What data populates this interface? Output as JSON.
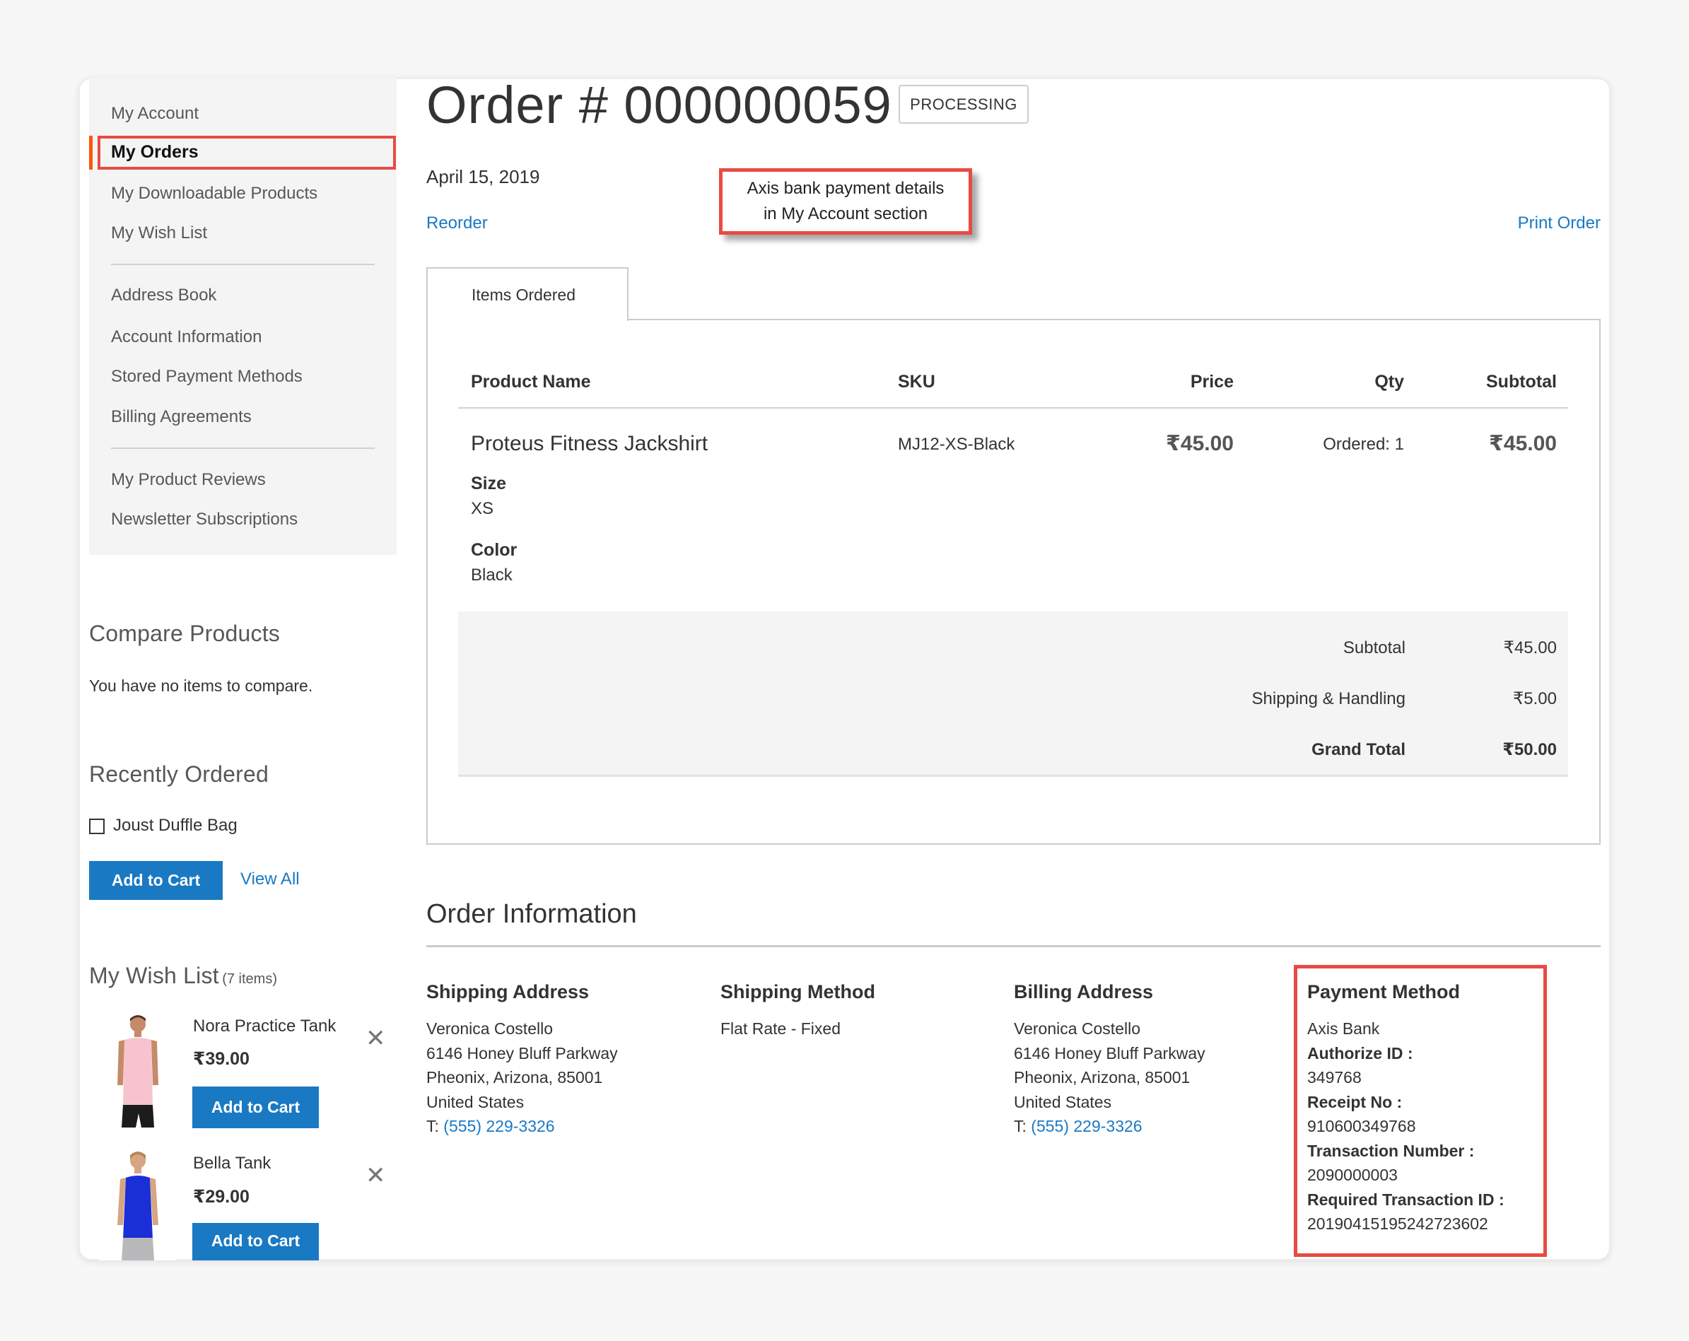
{
  "sidebar": {
    "nav_items": [
      {
        "label": "My Account",
        "active": false
      },
      {
        "label": "My Orders",
        "active": true
      },
      {
        "label": "My Downloadable Products",
        "active": false
      },
      {
        "label": "My Wish List",
        "active": false
      },
      {
        "label": "Address Book",
        "active": false
      },
      {
        "label": "Account Information",
        "active": false
      },
      {
        "label": "Stored Payment Methods",
        "active": false
      },
      {
        "label": "Billing Agreements",
        "active": false
      },
      {
        "label": "My Product Reviews",
        "active": false
      },
      {
        "label": "Newsletter Subscriptions",
        "active": false
      }
    ],
    "compare": {
      "heading": "Compare Products",
      "empty_text": "You have no items to compare."
    },
    "recently_ordered": {
      "heading": "Recently Ordered",
      "items": [
        {
          "label": "Joust Duffle Bag",
          "checked": false
        }
      ],
      "add_to_cart_label": "Add to Cart",
      "view_all_label": "View All"
    },
    "wishlist": {
      "heading": "My Wish List",
      "count_label": "(7 items)",
      "items": [
        {
          "name": "Nora Practice Tank",
          "price": "₹39.00",
          "add_to_cart_label": "Add to Cart",
          "image_color": "#f6c3cf"
        },
        {
          "name": "Bella Tank",
          "price": "₹29.00",
          "add_to_cart_label": "Add to Cart",
          "image_color": "#1a2fd6"
        }
      ]
    }
  },
  "order": {
    "title": "Order # 000000059",
    "status": "PROCESSING",
    "date": "April 15, 2019",
    "reorder_label": "Reorder",
    "print_label": "Print Order"
  },
  "annotation": {
    "line1": "Axis bank payment details",
    "line2": "in My Account section",
    "border_color": "#e84b43"
  },
  "tabs": {
    "items_ordered_label": "Items Ordered"
  },
  "items_table": {
    "headers": {
      "product_name": "Product Name",
      "sku": "SKU",
      "price": "Price",
      "qty": "Qty",
      "subtotal": "Subtotal"
    },
    "rows": [
      {
        "name": "Proteus Fitness Jackshirt",
        "sku": "MJ12-XS-Black",
        "price": "₹45.00",
        "qty": "Ordered: 1",
        "subtotal": "₹45.00",
        "options": [
          {
            "label": "Size",
            "value": "XS"
          },
          {
            "label": "Color",
            "value": "Black"
          }
        ]
      }
    ]
  },
  "totals": [
    {
      "label": "Subtotal",
      "value": "₹45.00",
      "bold": false
    },
    {
      "label": "Shipping & Handling",
      "value": "₹5.00",
      "bold": false
    },
    {
      "label": "Grand Total",
      "value": "₹50.00",
      "bold": true
    }
  ],
  "order_information": {
    "heading": "Order Information",
    "shipping_address": {
      "heading": "Shipping Address",
      "lines": [
        "Veronica Costello",
        "6146 Honey Bluff Parkway",
        "Pheonix, Arizona, 85001",
        "United States"
      ],
      "phone_prefix": "T: ",
      "phone": "(555) 229-3326"
    },
    "shipping_method": {
      "heading": "Shipping Method",
      "value": "Flat Rate - Fixed"
    },
    "billing_address": {
      "heading": "Billing Address",
      "lines": [
        "Veronica Costello",
        "6146 Honey Bluff Parkway",
        "Pheonix, Arizona, 85001",
        "United States"
      ],
      "phone_prefix": "T: ",
      "phone": "(555) 229-3326"
    },
    "payment_method": {
      "heading": "Payment Method",
      "name": "Axis Bank",
      "fields": [
        {
          "label": "Authorize ID :",
          "value": "349768"
        },
        {
          "label": "Receipt No :",
          "value": "910600349768"
        },
        {
          "label": "Transaction Number :",
          "value": "2090000003"
        },
        {
          "label": "Required Transaction ID :",
          "value": "20190415195242723602"
        }
      ]
    }
  },
  "colors": {
    "accent_blue": "#1979c3",
    "active_nav_bar": "#ff5501",
    "annotation_red": "#e84b43"
  }
}
